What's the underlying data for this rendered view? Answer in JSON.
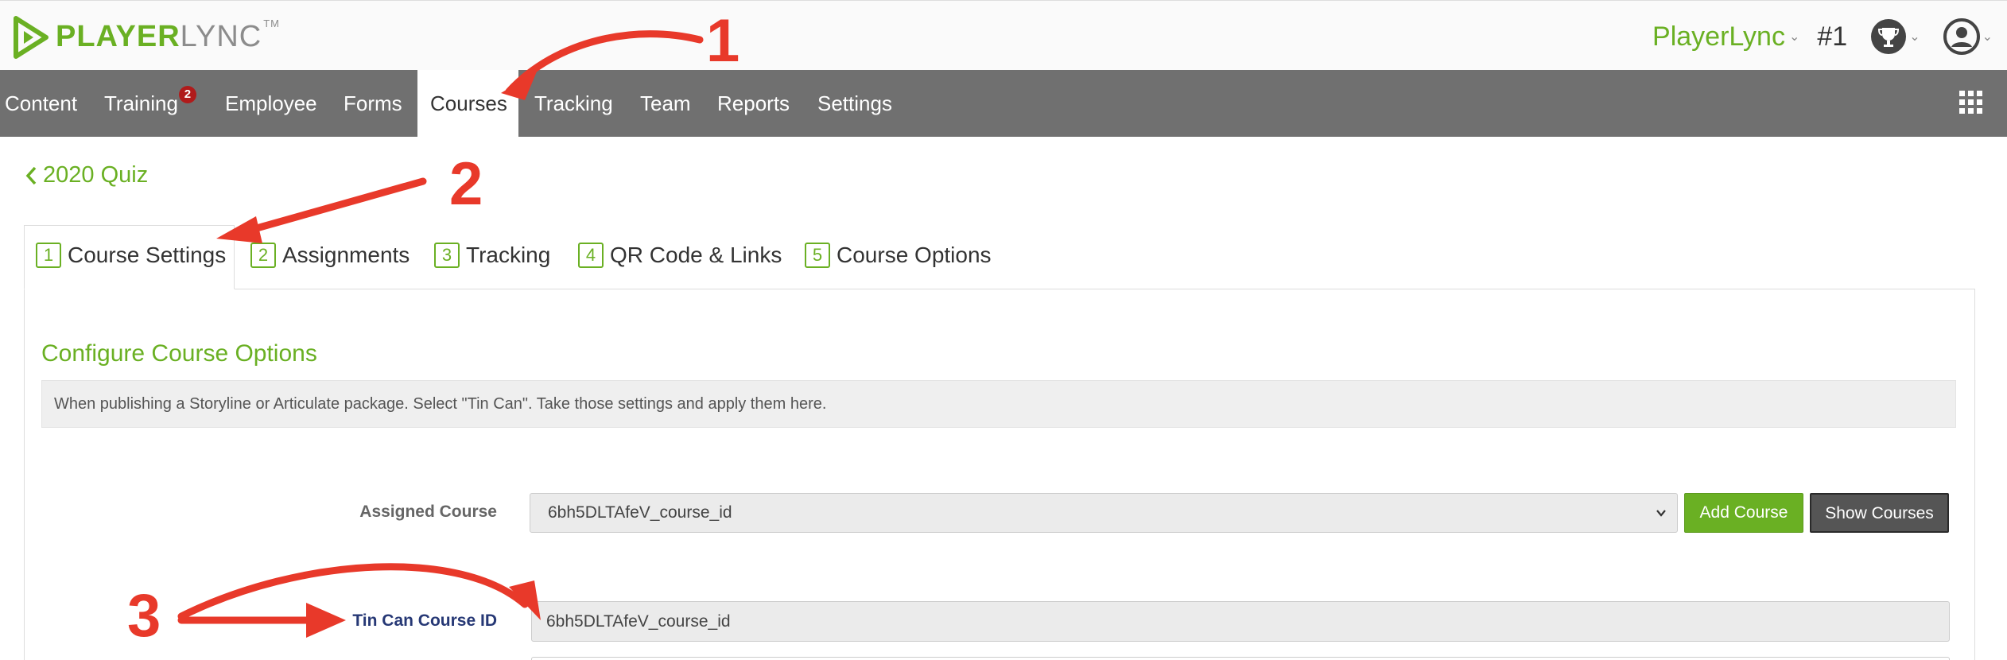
{
  "header": {
    "logo_player": "PLAYER",
    "logo_lync": "LYNC",
    "logo_tm": "TM",
    "account_name": "PlayerLync",
    "rank": "#1"
  },
  "nav": {
    "items": [
      {
        "label": "Content"
      },
      {
        "label": "Training",
        "badge": "2"
      },
      {
        "label": "Employee"
      },
      {
        "label": "Forms"
      },
      {
        "label": "Courses",
        "active": true
      },
      {
        "label": "Tracking"
      },
      {
        "label": "Team"
      },
      {
        "label": "Reports"
      },
      {
        "label": "Settings"
      }
    ]
  },
  "back_link": "2020 Quiz",
  "tabs": [
    {
      "num": "1",
      "label": "Course Settings",
      "active": true
    },
    {
      "num": "2",
      "label": "Assignments"
    },
    {
      "num": "3",
      "label": "Tracking"
    },
    {
      "num": "4",
      "label": "QR Code & Links"
    },
    {
      "num": "5",
      "label": "Course Options"
    }
  ],
  "section": {
    "title": "Configure Course Options",
    "info": "When publishing a Storyline or Articulate package. Select \"Tin Can\". Take those settings and apply them here."
  },
  "form": {
    "assigned_label": "Assigned Course",
    "assigned_value": "6bh5DLTAfeV_course_id",
    "add_button": "Add Course",
    "show_button": "Show Courses",
    "tincan_label": "Tin Can Course ID",
    "tincan_value": "6bh5DLTAfeV_course_id"
  },
  "annotations": {
    "one": "1",
    "two": "2",
    "three": "3",
    "color": "#e8392a"
  },
  "colors": {
    "brand_green": "#6ab023",
    "nav_bg": "#707070",
    "badge_red": "#b01b1b"
  }
}
